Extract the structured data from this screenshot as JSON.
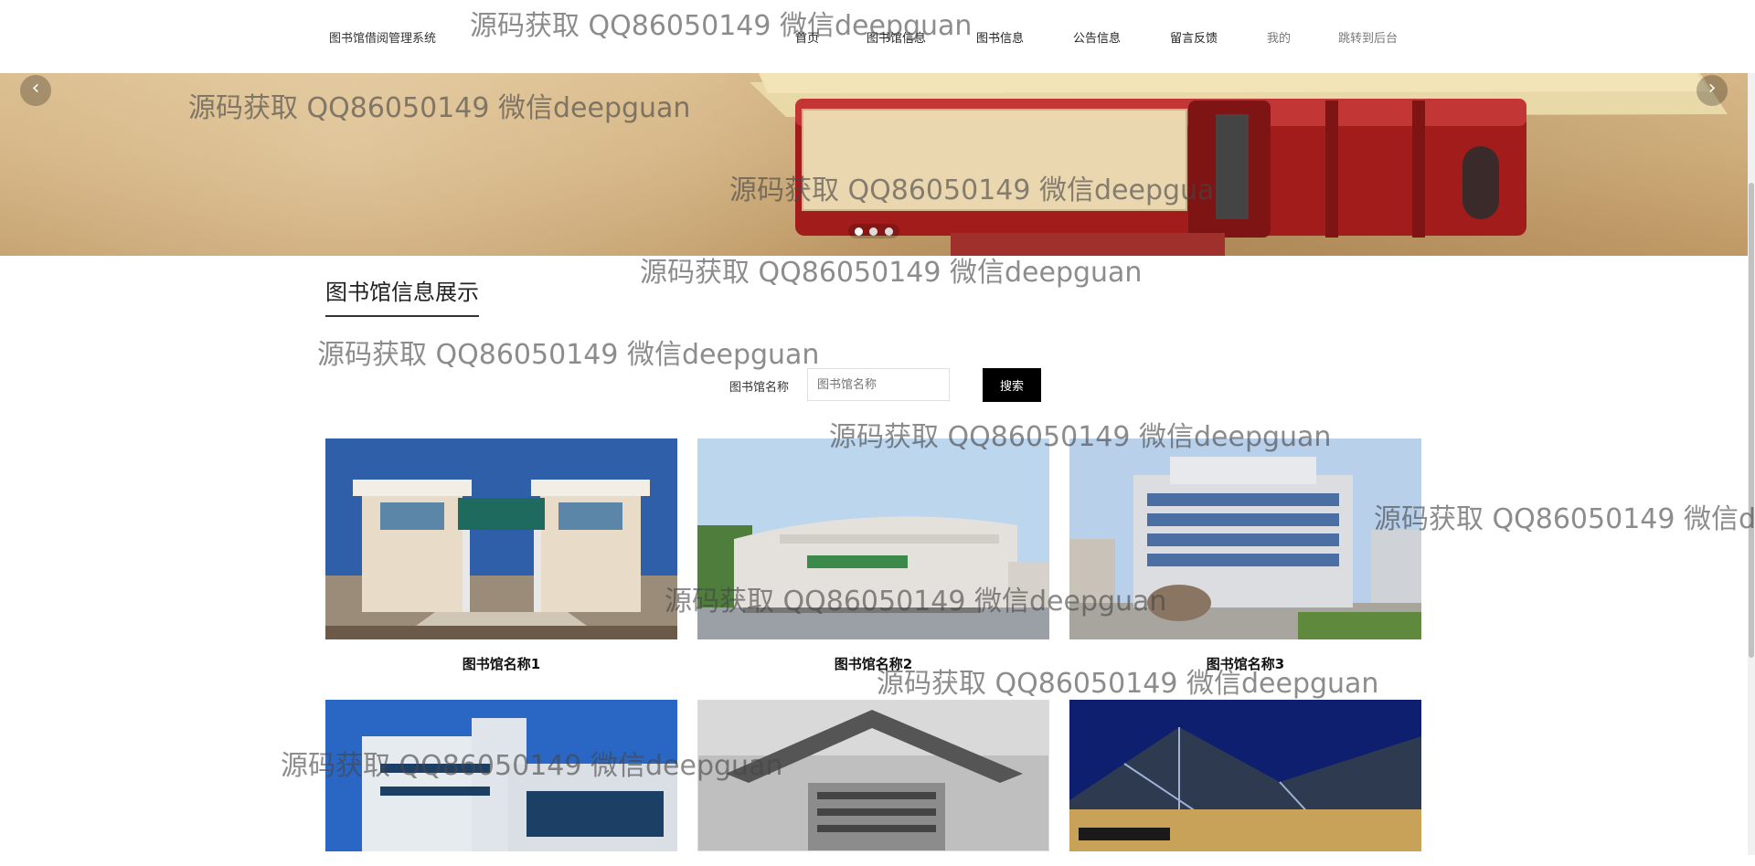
{
  "header": {
    "brand": "图书馆借阅管理系统",
    "nav": [
      "首页",
      "图书馆信息",
      "图书信息",
      "公告信息",
      "留言反馈",
      "我的",
      "跳转到后台"
    ]
  },
  "banner": {
    "slide_count": 3,
    "active_slide": 1,
    "prev_icon": "chevron-left-icon",
    "next_icon": "chevron-right-icon"
  },
  "section": {
    "title": "图书馆信息展示",
    "search_label": "图书馆名称",
    "search_placeholder": "图书馆名称",
    "search_button": "搜索"
  },
  "cards": [
    {
      "name": "图书馆名称1"
    },
    {
      "name": "图书馆名称2"
    },
    {
      "name": "图书馆名称3"
    },
    {
      "name": ""
    },
    {
      "name": ""
    },
    {
      "name": ""
    }
  ],
  "watermark": "源码获取 QQ86050149 微信deepguan"
}
